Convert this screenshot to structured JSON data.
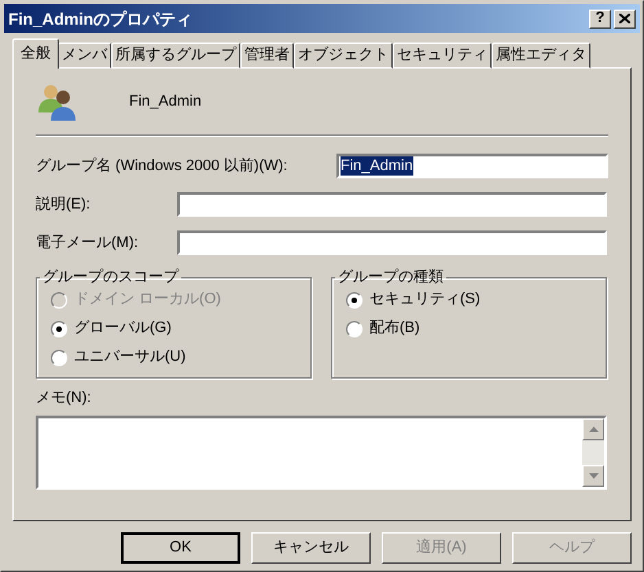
{
  "window": {
    "title": "Fin_Adminのプロパティ",
    "help_button": "?"
  },
  "tabs": [
    {
      "label": "全般",
      "selected": true
    },
    {
      "label": "メンバ",
      "selected": false
    },
    {
      "label": "所属するグループ",
      "selected": false
    },
    {
      "label": "管理者",
      "selected": false
    },
    {
      "label": "オブジェクト",
      "selected": false
    },
    {
      "label": "セキュリティ",
      "selected": false
    },
    {
      "label": "属性エディタ",
      "selected": false
    }
  ],
  "object_name": "Fin_Admin",
  "fields": [
    {
      "label": "グループ名 (Windows 2000 以前)(W):",
      "value": "Fin_Admin",
      "text_selected": true
    },
    {
      "label": "説明(E):"
    },
    {
      "label": "電子メール(M):"
    }
  ],
  "scope_group": {
    "title": "グループのスコープ",
    "options": [
      {
        "label": "ドメイン ローカル(O)",
        "selected": false,
        "disabled": true
      },
      {
        "label": "グローバル(G)",
        "selected": true,
        "disabled": false
      },
      {
        "label": "ユニバーサル(U)",
        "selected": false,
        "disabled": false
      }
    ]
  },
  "type_group": {
    "title": "グループの種類",
    "options": [
      {
        "label": "セキュリティ(S)",
        "selected": true,
        "disabled": false
      },
      {
        "label": "配布(B)",
        "selected": false,
        "disabled": false
      }
    ]
  },
  "notes": {
    "label": "メモ(N):"
  },
  "buttons": [
    {
      "label": "OK",
      "default": true,
      "disabled": false
    },
    {
      "label": "キャンセル",
      "default": false,
      "disabled": false
    },
    {
      "label": "適用(A)",
      "default": false,
      "disabled": true
    },
    {
      "label": "ヘルプ",
      "default": false,
      "disabled": true
    }
  ]
}
